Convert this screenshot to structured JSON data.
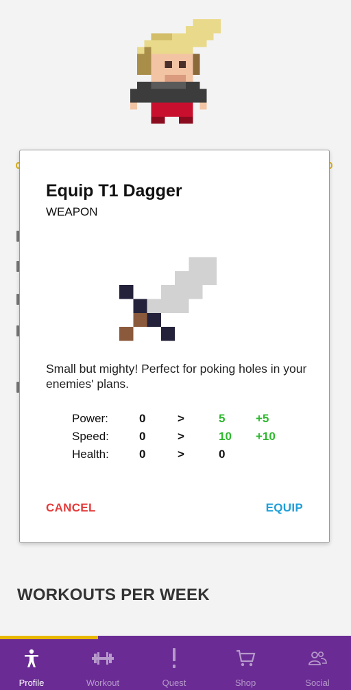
{
  "dialog": {
    "title": "Equip T1 Dagger",
    "subtitle": "WEAPON",
    "description": "Small but mighty! Perfect for poking holes in your enemies' plans.",
    "stats": [
      {
        "label": "Power:",
        "current": "0",
        "arrow": ">",
        "new": "5",
        "diff": "+5"
      },
      {
        "label": "Speed:",
        "current": "0",
        "arrow": ">",
        "new": "10",
        "diff": "+10"
      },
      {
        "label": "Health:",
        "current": "0",
        "arrow": ">",
        "new": "0",
        "diff": ""
      }
    ],
    "cancel_label": "CANCEL",
    "equip_label": "EQUIP"
  },
  "section": {
    "title": "WORKOUTS PER WEEK"
  },
  "nav": {
    "items": [
      {
        "label": "Profile",
        "icon": "person-icon",
        "active": true
      },
      {
        "label": "Workout",
        "icon": "dumbbell-icon",
        "active": false
      },
      {
        "label": "Quest",
        "icon": "exclamation-icon",
        "active": false
      },
      {
        "label": "Shop",
        "icon": "cart-icon",
        "active": false
      },
      {
        "label": "Social",
        "icon": "people-icon",
        "active": false
      }
    ]
  },
  "colors": {
    "nav_bg": "#6a2c94",
    "nav_indicator": "#e8b800",
    "cancel": "#e53b3b",
    "equip": "#1e9fd9",
    "stat_gain": "#2db82d"
  }
}
